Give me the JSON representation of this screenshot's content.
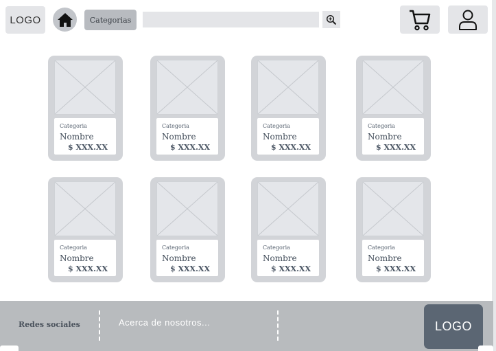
{
  "header": {
    "logo_text": "LOGO",
    "home_icon": "home-icon",
    "categories_label": "Categorias",
    "search": {
      "value": "",
      "placeholder": ""
    },
    "search_icon": "zoom-in-icon",
    "cart_icon": "cart-icon",
    "user_icon": "user-icon"
  },
  "products": [
    {
      "category": "Categoria",
      "name": "Nombre",
      "price": "$ XXX.XX"
    },
    {
      "category": "Categoria",
      "name": "Nombre",
      "price": "$ XXX.XX"
    },
    {
      "category": "Categoria",
      "name": "Nombre",
      "price": "$ XXX.XX"
    },
    {
      "category": "Categoria",
      "name": "Nombre",
      "price": "$ XXX.XX"
    },
    {
      "category": "Categoria",
      "name": "Nombre",
      "price": "$ XXX.XX"
    },
    {
      "category": "Categoria",
      "name": "Nombre",
      "price": "$ XXX.XX"
    },
    {
      "category": "Categoria",
      "name": "Nombre",
      "price": "$ XXX.XX"
    },
    {
      "category": "Categoria",
      "name": "Nombre",
      "price": "$ XXX.XX"
    }
  ],
  "footer": {
    "social_label": "Redes sociales",
    "about_label": "Acerca de nosotros...",
    "logo_text": "LOGO"
  },
  "colors": {
    "footer_bg": "#b8bbbe",
    "footer_logo_bg": "#5b6673",
    "card_bg": "#d2d4d8"
  }
}
